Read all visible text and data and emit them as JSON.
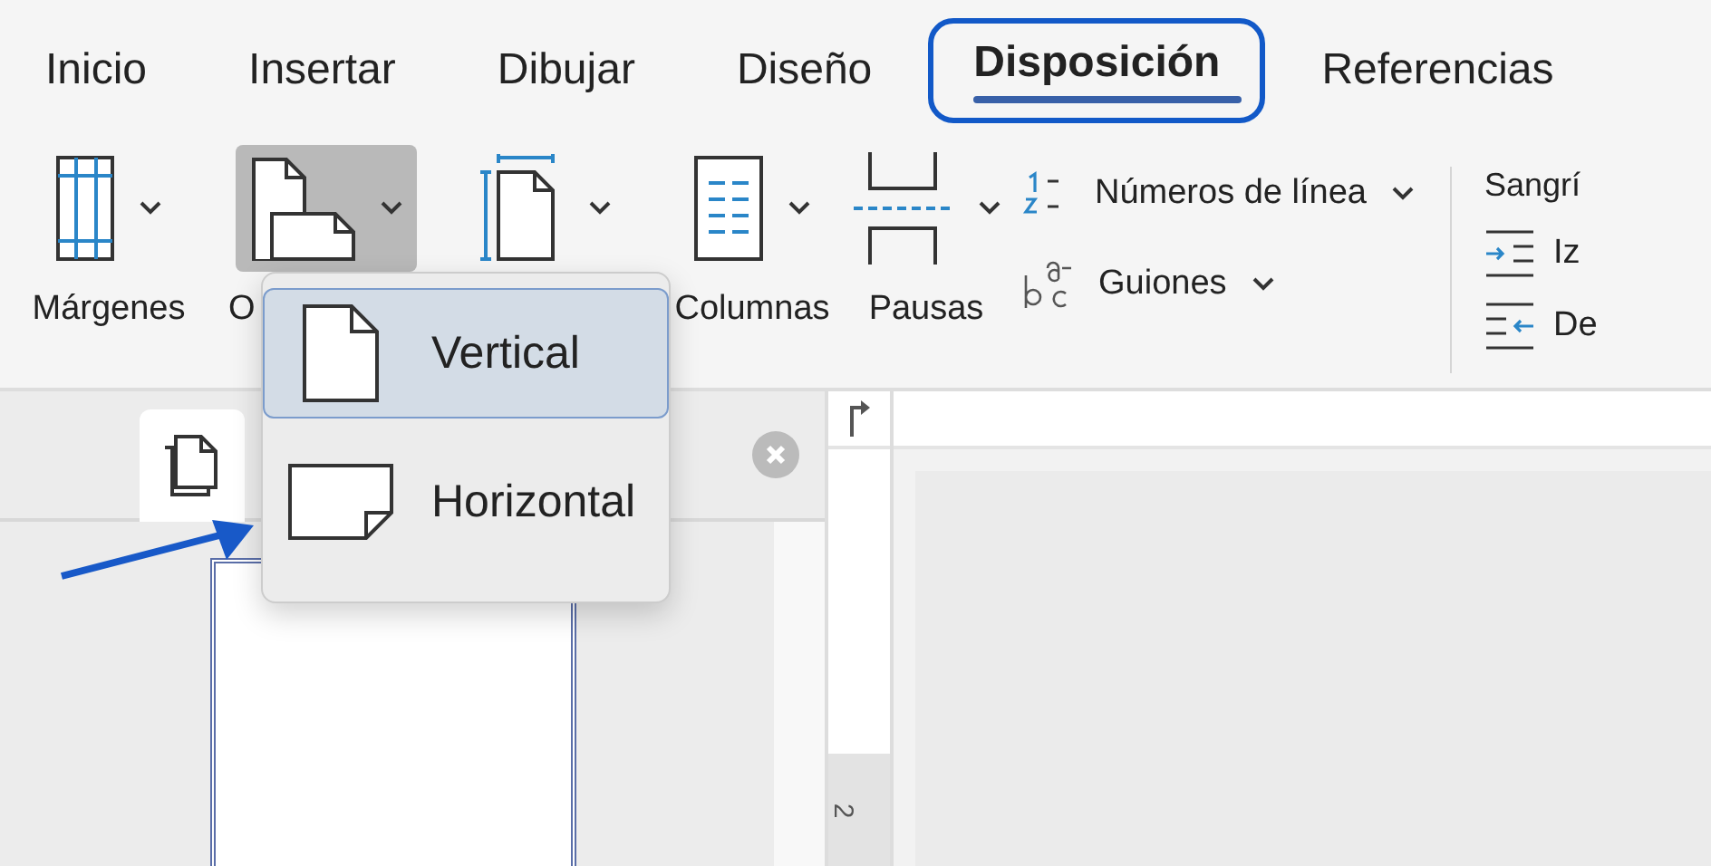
{
  "tabs": [
    {
      "label": "Inicio",
      "selected": false
    },
    {
      "label": "Insertar",
      "selected": false
    },
    {
      "label": "Dibujar",
      "selected": false
    },
    {
      "label": "Diseño",
      "selected": false
    },
    {
      "label": "Disposición",
      "selected": true
    },
    {
      "label": "Referencias",
      "selected": false
    }
  ],
  "ribbon": {
    "large_buttons": [
      {
        "kind": "margins",
        "label": "Márgenes",
        "pressed": false
      },
      {
        "kind": "orientation",
        "label": "O",
        "pressed": true
      },
      {
        "kind": "size",
        "pressed": false
      },
      {
        "kind": "columns",
        "label": "Columnas",
        "pressed": false
      },
      {
        "kind": "breaks",
        "label": "Pausas",
        "pressed": false
      }
    ],
    "small_buttons": [
      {
        "kind": "line-numbers",
        "label": "Números de línea"
      },
      {
        "kind": "hyphenation",
        "label": "Guiones"
      }
    ],
    "indent": {
      "title": "Sangrí",
      "items": [
        {
          "kind": "left",
          "label": "Iz"
        },
        {
          "kind": "right",
          "label": "De"
        }
      ]
    }
  },
  "orientation_menu": [
    {
      "kind": "portrait",
      "label": "Vertical",
      "selected": true
    },
    {
      "kind": "landscape",
      "label": "Horizontal",
      "selected": false
    }
  ],
  "vertical_ruler": {
    "number": "2"
  }
}
